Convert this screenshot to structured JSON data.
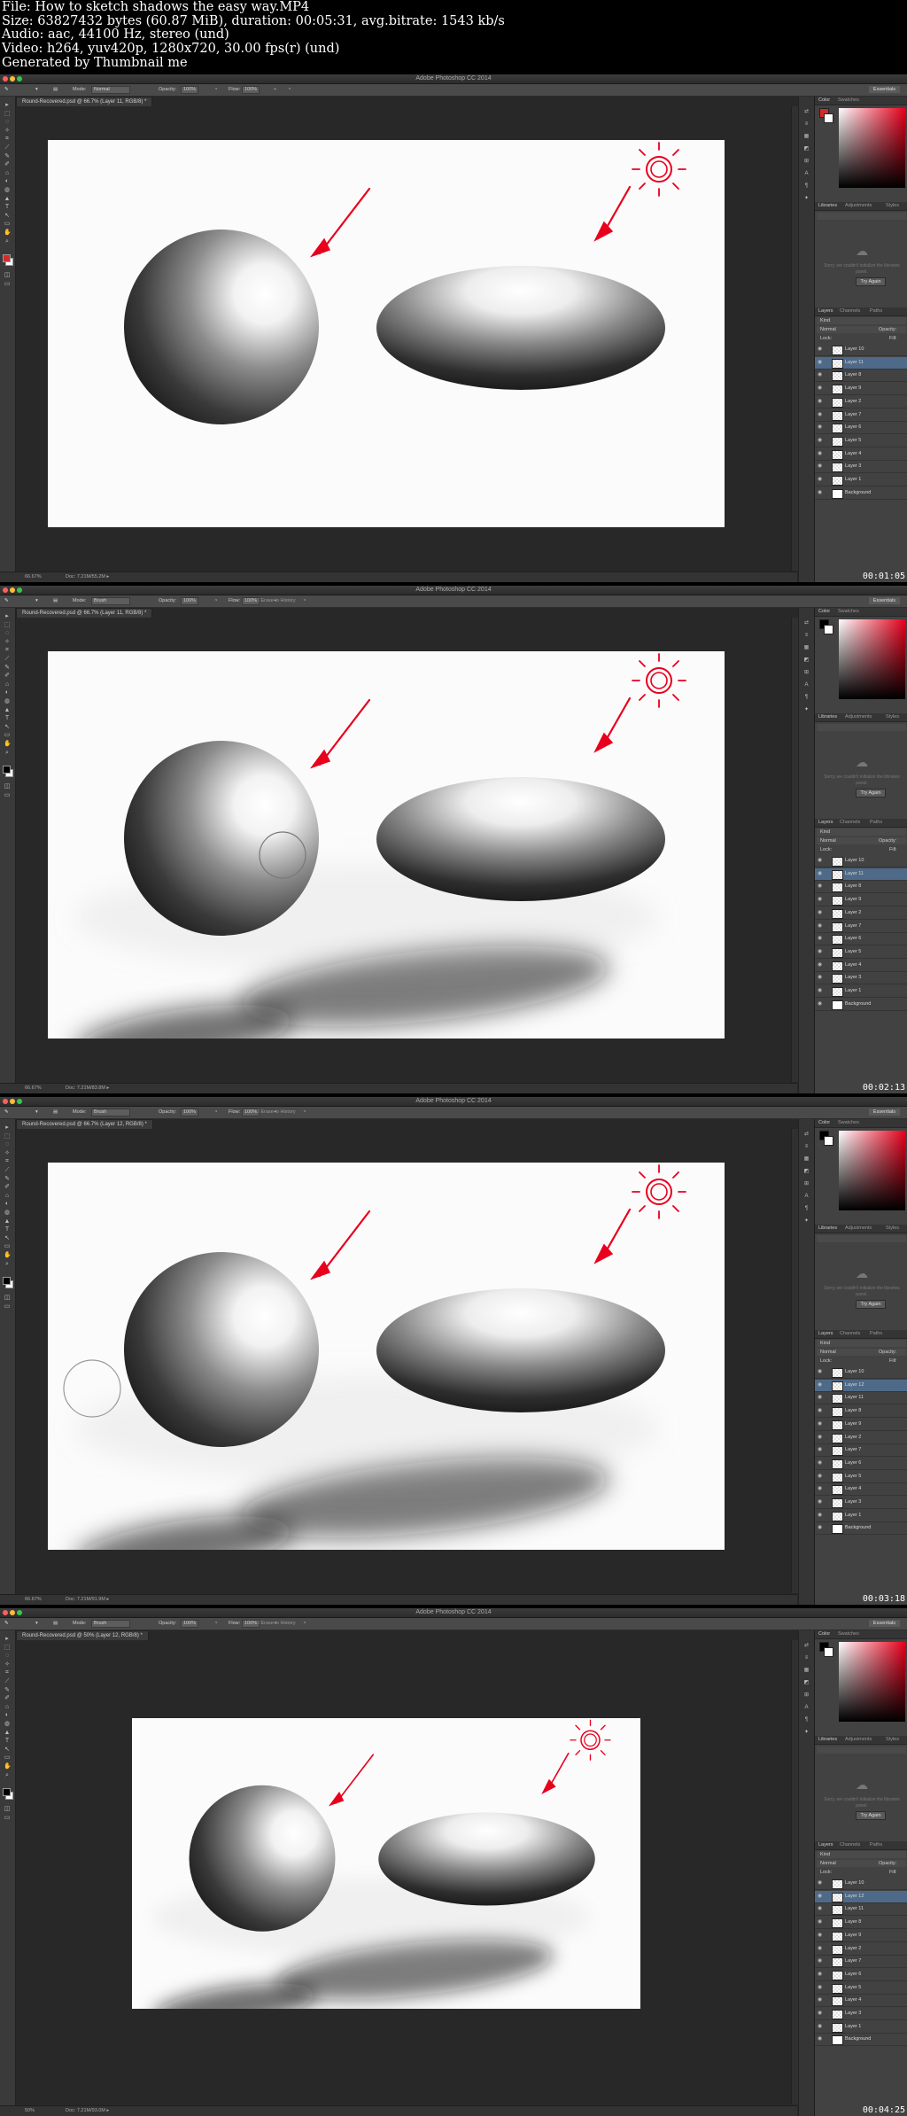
{
  "header": {
    "line1": "File: How to sketch shadows the easy way.MP4",
    "line2": "Size: 63827432 bytes (60.87 MiB), duration: 00:05:31, avg.bitrate: 1543 kb/s",
    "line3": "Audio: aac, 44100 Hz, stereo (und)",
    "line4": "Video: h264, yuv420p, 1280x720, 30.00 fps(r) (und)",
    "line5": "Generated by Thumbnail me"
  },
  "app": {
    "title": "Adobe Photoshop CC 2014",
    "workspace_button": "Essentials",
    "traffic_light_colors": [
      "#fc605c",
      "#fdbc40",
      "#34c84a"
    ]
  },
  "options_bar": {
    "mode_label": "Mode:",
    "opacity_label": "Opacity:",
    "opacity_value": "100%",
    "flow_label": "Flow:",
    "flow_value": "100%",
    "erase_to_history": "Erase to History"
  },
  "panels": {
    "color_tab": "Color",
    "swatches_tab": "Swatches",
    "libraries_tab": "Libraries",
    "adjustments_tab": "Adjustments",
    "styles_tab": "Styles",
    "library_message": "Sorry, we couldn't initialize the libraries panel.",
    "try_again": "Try Again",
    "layers_tab": "Layers",
    "channels_tab": "Channels",
    "paths_tab": "Paths",
    "kind_label": "Kind",
    "blend_mode": "Normal",
    "opacity_label": "Opacity:",
    "lock_label": "Lock:",
    "fill_label": "Fill:",
    "accent_color": "#e8001c"
  },
  "frames": [
    {
      "doc_tab": "Round-Recovered.psd @ 66.7% (Layer 11, RGB/8) *",
      "mode": "Normal",
      "brush_mode": "",
      "show_erase": false,
      "zoom": "66.67%",
      "doc_size": "Doc: 7.21M/55.2M",
      "timestamp": "00:01:05",
      "shadows": false,
      "brush_cursor": null,
      "selected_layer": 1,
      "layers": [
        "Layer 10",
        "Layer 11",
        "Layer 8",
        "Layer 9",
        "Layer 2",
        "Layer 7",
        "Layer 6",
        "Layer 5",
        "Layer 4",
        "Layer 3",
        "Layer 1",
        "Background"
      ],
      "fg_color": "#d62a2a",
      "bg_color": "#ffffff"
    },
    {
      "doc_tab": "Round-Recovered.psd @ 66.7% (Layer 11, RGB/8) *",
      "mode": "Brush",
      "brush_mode": "Brush",
      "show_erase": true,
      "zoom": "66.67%",
      "doc_size": "Doc: 7.21M/83.8M",
      "timestamp": "00:02:13",
      "shadows": true,
      "brush_cursor": "egg",
      "selected_layer": 1,
      "layers": [
        "Layer 10",
        "Layer 11",
        "Layer 8",
        "Layer 9",
        "Layer 2",
        "Layer 7",
        "Layer 6",
        "Layer 5",
        "Layer 4",
        "Layer 3",
        "Layer 1",
        "Background"
      ],
      "fg_color": "#000000",
      "bg_color": "#ffffff"
    },
    {
      "doc_tab": "Round-Recovered.psd @ 66.7% (Layer 12, RGB/8) *",
      "mode": "Brush",
      "brush_mode": "Brush",
      "show_erase": true,
      "zoom": "66.67%",
      "doc_size": "Doc: 7.21M/91.9M",
      "timestamp": "00:03:18",
      "shadows": true,
      "brush_cursor": "sphere",
      "selected_layer": 1,
      "layers": [
        "Layer 10",
        "Layer 12",
        "Layer 11",
        "Layer 8",
        "Layer 9",
        "Layer 2",
        "Layer 7",
        "Layer 6",
        "Layer 5",
        "Layer 4",
        "Layer 3",
        "Layer 1",
        "Background"
      ],
      "fg_color": "#000000",
      "bg_color": "#ffffff"
    },
    {
      "doc_tab": "Round-Recovered.psd @ 50% (Layer 12, RGB/8) *",
      "mode": "Brush",
      "brush_mode": "Brush",
      "show_erase": true,
      "zoom": "50%",
      "doc_size": "Doc: 7.21M/93.0M",
      "timestamp": "00:04:25",
      "shadows": true,
      "brush_cursor": null,
      "selected_layer": 1,
      "layers": [
        "Layer 10",
        "Layer 12",
        "Layer 11",
        "Layer 8",
        "Layer 9",
        "Layer 2",
        "Layer 7",
        "Layer 6",
        "Layer 5",
        "Layer 4",
        "Layer 3",
        "Layer 1",
        "Background"
      ],
      "fg_color": "#000000",
      "bg_color": "#ffffff"
    }
  ]
}
